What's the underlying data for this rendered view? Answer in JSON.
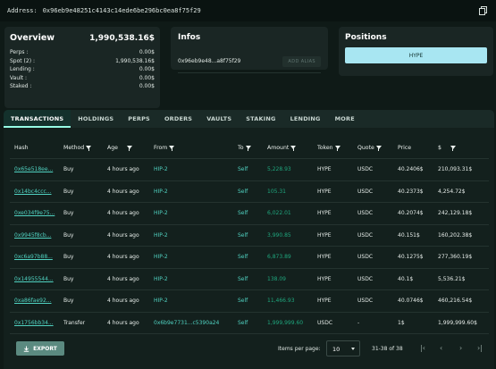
{
  "address_bar": {
    "label": "Address:",
    "address": "0x96eb9e48251c4143c14ede6be296bc0ea8f75f29"
  },
  "overview": {
    "title": "Overview",
    "total": "1,990,538.16$",
    "rows": [
      {
        "label": "Perps :",
        "value": "0.00$"
      },
      {
        "label": "Spot (2) :",
        "value": "1,990,538.16$"
      },
      {
        "label": "Lending :",
        "value": "0.00$"
      },
      {
        "label": "Vault :",
        "value": "0.00$"
      },
      {
        "label": "Staked :",
        "value": "0.00$"
      }
    ]
  },
  "infos": {
    "title": "Infos",
    "short_address": "0x96eb9e48...a8f75f29",
    "add_alias_label": "ADD ALIAS"
  },
  "positions": {
    "title": "Positions",
    "pill": "HYPE"
  },
  "tabs": [
    "TRANSACTIONS",
    "HOLDINGS",
    "PERPS",
    "ORDERS",
    "VAULTS",
    "STAKING",
    "LENDING",
    "MORE"
  ],
  "table": {
    "headers": [
      "Hash",
      "Method",
      "Age",
      "From",
      "To",
      "Amount",
      "Token",
      "Quote",
      "Price",
      "$"
    ],
    "rows": [
      {
        "hash": "0x65e518ee...",
        "method": "Buy",
        "age": "4 hours ago",
        "from": "HIP-2",
        "to": "Self",
        "amount": "5,228.93",
        "token": "HYPE",
        "quote": "USDC",
        "price": "40.2406$",
        "usd": "210,093.31$"
      },
      {
        "hash": "0x14bc4ccc...",
        "method": "Buy",
        "age": "4 hours ago",
        "from": "HIP-2",
        "to": "Self",
        "amount": "105.31",
        "token": "HYPE",
        "quote": "USDC",
        "price": "40.2373$",
        "usd": "4,254.72$"
      },
      {
        "hash": "0xe034f9e75...",
        "method": "Buy",
        "age": "4 hours ago",
        "from": "HIP-2",
        "to": "Self",
        "amount": "6,022.01",
        "token": "HYPE",
        "quote": "USDC",
        "price": "40.2074$",
        "usd": "242,129.18$"
      },
      {
        "hash": "0x9945f8cb...",
        "method": "Buy",
        "age": "4 hours ago",
        "from": "HIP-2",
        "to": "Self",
        "amount": "3,990.85",
        "token": "HYPE",
        "quote": "USDC",
        "price": "40.151$",
        "usd": "160,202.38$"
      },
      {
        "hash": "0xc6a97b88...",
        "method": "Buy",
        "age": "4 hours ago",
        "from": "HIP-2",
        "to": "Self",
        "amount": "6,873.89",
        "token": "HYPE",
        "quote": "USDC",
        "price": "40.1275$",
        "usd": "277,360.19$"
      },
      {
        "hash": "0x14955544...",
        "method": "Buy",
        "age": "4 hours ago",
        "from": "HIP-2",
        "to": "Self",
        "amount": "138.09",
        "token": "HYPE",
        "quote": "USDC",
        "price": "40.1$",
        "usd": "5,536.21$"
      },
      {
        "hash": "0xa86fae92...",
        "method": "Buy",
        "age": "4 hours ago",
        "from": "HIP-2",
        "to": "Self",
        "amount": "11,466.93",
        "token": "HYPE",
        "quote": "USDC",
        "price": "40.0746$",
        "usd": "460,216.54$"
      },
      {
        "hash": "0x1756bb34...",
        "method": "Transfer",
        "age": "4 hours ago",
        "from": "0x6b9e7731...c5390a24",
        "to": "Self",
        "amount": "1,999,999.60",
        "token": "USDC",
        "quote": "-",
        "price": "1$",
        "usd": "1,999,999.60$"
      }
    ]
  },
  "footer": {
    "export_label": "EXPORT",
    "items_per_page_label": "Items per page:",
    "items_per_page_value": "10",
    "range": "31-38 of 38"
  },
  "colors": {
    "accent": "#97fce4",
    "link": "#50d2c1",
    "amount": "#1fa67d",
    "card": "#1a2624",
    "background": "#0f1a17"
  }
}
